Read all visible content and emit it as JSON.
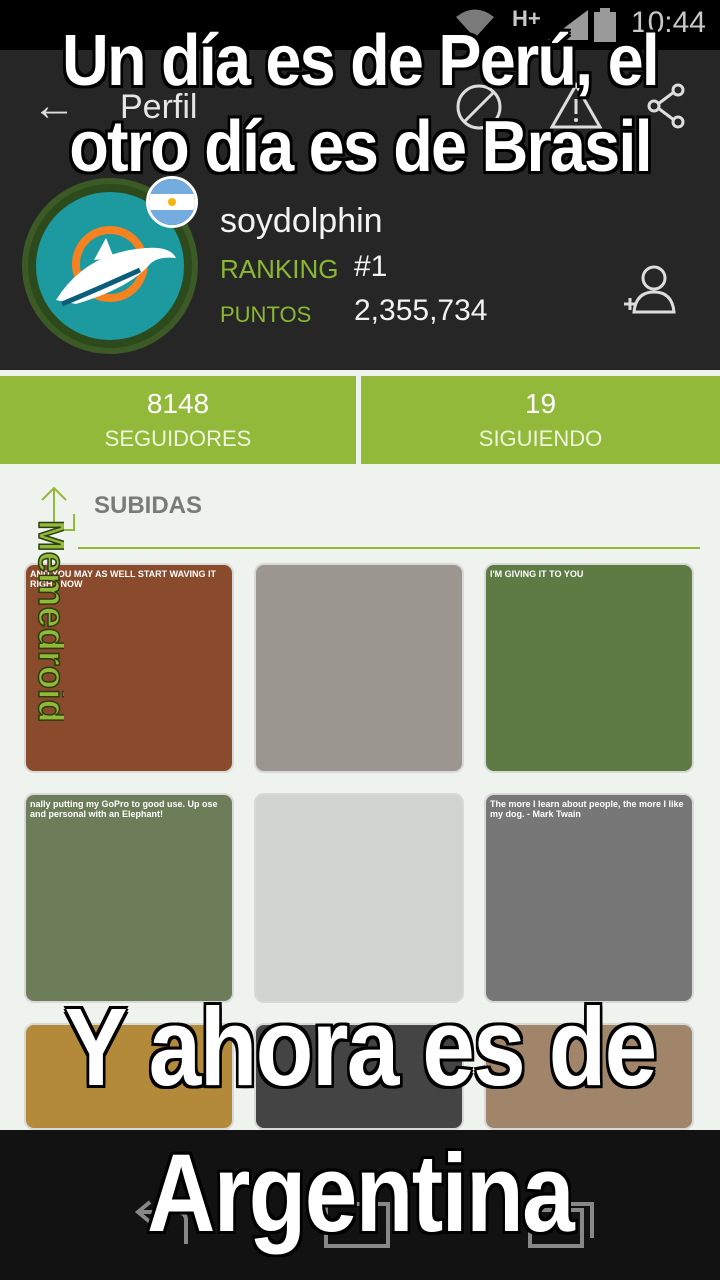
{
  "status_bar": {
    "network": "H+",
    "time": "10:44"
  },
  "app_bar": {
    "title": "Perfil"
  },
  "profile": {
    "username": "soydolphin",
    "ranking_label": "RANKING",
    "ranking_value": "#1",
    "points_label": "PUNTOS",
    "points_value": "2,355,734"
  },
  "stats": [
    {
      "value": "8148",
      "label": "SEGUIDORES"
    },
    {
      "value": "19",
      "label": "SIGUIENDO"
    }
  ],
  "uploads": {
    "label": "SUBIDAS",
    "thumbs": [
      {
        "caption": "AND YOU MAY AS WELL START WAVING IT RIGHT NOW",
        "bg": "#8a4a2c"
      },
      {
        "caption": "",
        "bg": "#9b9690"
      },
      {
        "caption": "I'M GIVING IT TO YOU",
        "bg": "#5e7b44"
      },
      {
        "caption": "nally putting my GoPro to good use. Up ose and personal with an Elephant!",
        "bg": "#6d7d5a"
      },
      {
        "caption": "",
        "bg": "#cfd4cf"
      },
      {
        "caption": "The more I learn about people, the more I like my dog. - Mark Twain",
        "bg": "#777"
      },
      {
        "caption": "",
        "bg": "#b38a3a"
      },
      {
        "caption": "",
        "bg": "#444"
      },
      {
        "caption": "",
        "bg": "#a0856a"
      }
    ]
  },
  "watermark": "Memedroid",
  "meme_text": {
    "top": "Un día es de Perú, el otro día es de Brasil",
    "bottom_line1": "Y ahora es de",
    "bottom_line2": "Argentina"
  },
  "colors": {
    "accent_green": "#93b93a",
    "dark_bg": "#262626"
  }
}
